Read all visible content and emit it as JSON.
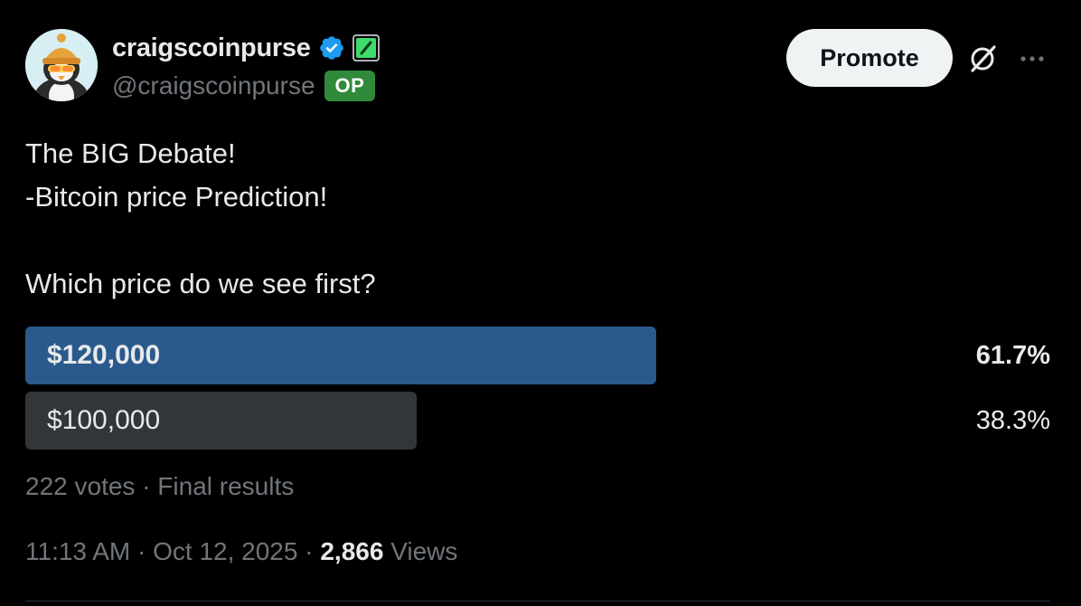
{
  "author": {
    "display_name": "craigscoinpurse",
    "handle": "@craigscoinpurse",
    "badge": "OP",
    "verified_icon": "verified-badge-icon",
    "affiliate_icon": "green-affiliate-icon"
  },
  "header_actions": {
    "promote_label": "Promote",
    "grok_icon": "grok-icon",
    "more_icon": "more-icon"
  },
  "tweet": {
    "line1": "The BIG Debate!",
    "line2": "-Bitcoin price Prediction!",
    "line3": "Which price do we see first?"
  },
  "poll": {
    "options": [
      {
        "label": "$120,000",
        "percent_text": "61.7%",
        "percent": 61.7,
        "winner": true
      },
      {
        "label": "$100,000",
        "percent_text": "38.3%",
        "percent": 38.3,
        "winner": false
      }
    ],
    "meta": "222 votes · Final results"
  },
  "footer": {
    "time": "11:13 AM",
    "date": "Oct 12, 2025",
    "views_count": "2,866",
    "views_label": "Views",
    "separator": "·"
  },
  "colors": {
    "background": "#000000",
    "winner_bar": "#2a5a8c",
    "other_bar": "#333639",
    "muted_text": "#71767b",
    "op_badge": "#2f8a3a",
    "verified_blue": "#1d9bf0"
  }
}
